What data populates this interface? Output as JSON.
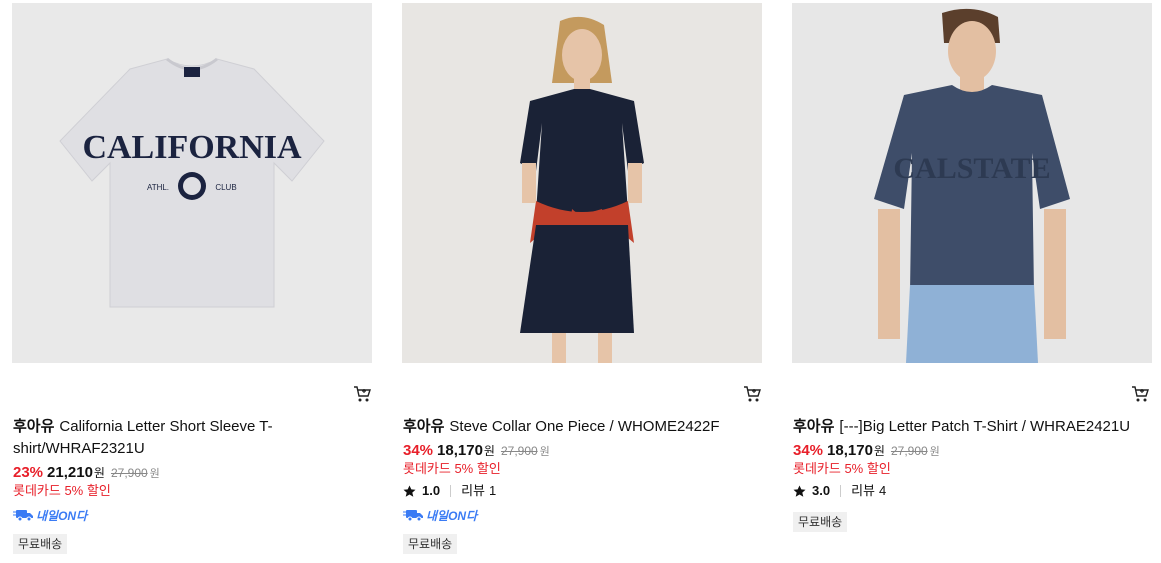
{
  "products": [
    {
      "brand": "후아유",
      "name": "California Letter Short Sleeve T-shirt/WHRAF2321U",
      "image_text": [
        "CALIFORNIA",
        "ATHL.",
        "CLUB"
      ],
      "discount": "23%",
      "price": "21,210",
      "currency": "원",
      "original_price": "27,900",
      "card_discount": "롯데카드 5% 할인",
      "delivery_badge": "내일ON다",
      "shipping_badge": "무료배송",
      "colors": {
        "background": "#e9e9e9",
        "garment": "#dfdfe3",
        "print": "#1b2340"
      }
    },
    {
      "brand": "후아유",
      "name": "Steve Collar One Piece / WHOME2422F",
      "discount": "34%",
      "price": "18,170",
      "currency": "원",
      "original_price": "27,900",
      "card_discount": "롯데카드 5% 할인",
      "rating": "1.0",
      "review_label": "리뷰",
      "review_count": "1",
      "delivery_badge": "내일ON다",
      "shipping_badge": "무료배송",
      "colors": {
        "background": "#e8e6e3",
        "dress": "#1a2236",
        "sweater": "#c2402b"
      }
    },
    {
      "brand": "후아유",
      "name": "[---]Big Letter Patch T-Shirt / WHRAE2421U",
      "image_text": [
        "CALSTATE"
      ],
      "discount": "34%",
      "price": "18,170",
      "currency": "원",
      "original_price": "27,900",
      "card_discount": "롯데카드 5% 할인",
      "rating": "3.0",
      "review_label": "리뷰",
      "review_count": "4",
      "shipping_badge": "무료배송",
      "colors": {
        "background": "#e7e7e7",
        "tee": "#3e4d69",
        "jeans": "#8fb1d6"
      }
    }
  ],
  "icons": [
    "cart-icon",
    "star-icon",
    "delivery-truck-icon"
  ],
  "accent_color": "#e8202a",
  "delivery_color": "#3a7bf4"
}
